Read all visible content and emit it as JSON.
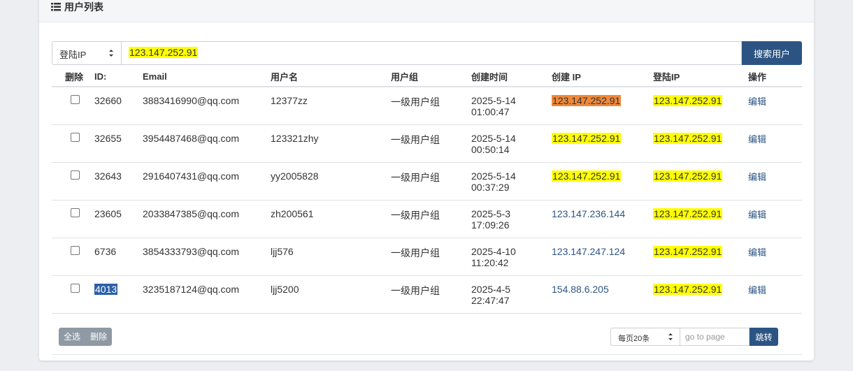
{
  "panel": {
    "title": "用户列表"
  },
  "search": {
    "field_select": "登陆IP",
    "query": "123.147.252.91",
    "button_label": "搜索用户"
  },
  "table": {
    "headers": [
      "删除",
      "ID:",
      "Email",
      "用户名",
      "用户组",
      "创建时间",
      "创建 IP",
      "登陆IP",
      "操作"
    ],
    "rows": [
      {
        "id": "32660",
        "email": "3883416990@qq.com",
        "username": "12377zz",
        "group": "一级用户组",
        "date": "2025-5-14",
        "time": "01:00:47",
        "create_ip": "123.147.252.91",
        "login_ip": "123.147.252.91",
        "action": "编辑"
      },
      {
        "id": "32655",
        "email": "3954487468@qq.com",
        "username": "123321zhy",
        "group": "一级用户组",
        "date": "2025-5-14",
        "time": "00:50:14",
        "create_ip": "123.147.252.91",
        "login_ip": "123.147.252.91",
        "action": "编辑"
      },
      {
        "id": "32643",
        "email": "2916407431@qq.com",
        "username": "yy2005828",
        "group": "一级用户组",
        "date": "2025-5-14",
        "time": "00:37:29",
        "create_ip": "123.147.252.91",
        "login_ip": "123.147.252.91",
        "action": "编辑"
      },
      {
        "id": "23605",
        "email": "2033847385@qq.com",
        "username": "zh200561",
        "group": "一级用户组",
        "date": "2025-5-3",
        "time": "17:09:26",
        "create_ip": "123.147.236.144",
        "login_ip": "123.147.252.91",
        "action": "编辑"
      },
      {
        "id": "6736",
        "email": "3854333793@qq.com",
        "username": "ljj576",
        "group": "一级用户组",
        "date": "2025-4-10",
        "time": "11:20:42",
        "create_ip": "123.147.247.124",
        "login_ip": "123.147.252.91",
        "action": "编辑"
      },
      {
        "id": "4013",
        "email": "3235187124@qq.com",
        "username": "ljj5200",
        "group": "一级用户组",
        "date": "2025-4-5",
        "time": "22:47:47",
        "create_ip": "154.88.6.205",
        "login_ip": "123.147.252.91",
        "action": "编辑"
      }
    ]
  },
  "footer": {
    "select_all": "全选",
    "delete": "删除",
    "per_page": "每页20条",
    "goto_placeholder": "go to page",
    "jump": "跳转"
  },
  "colors": {
    "primary": "#2c5483",
    "highlight": "#ffff00",
    "highlight_active": "#f08838"
  }
}
